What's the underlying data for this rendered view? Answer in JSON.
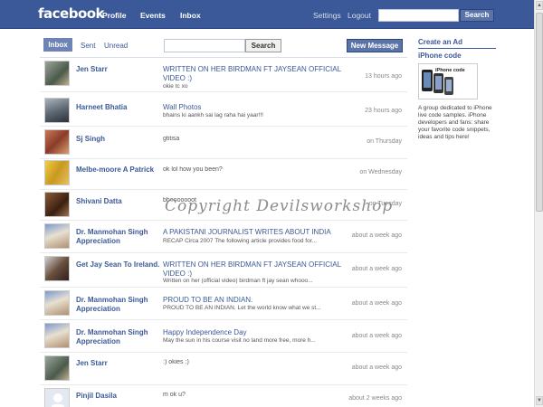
{
  "topbar": {
    "logo": "facebook",
    "nav": [
      "Profile",
      "Events",
      "Inbox"
    ],
    "settings": "Settings",
    "logout": "Logout",
    "search_button": "Search"
  },
  "inbox": {
    "tabs": [
      "Inbox",
      "Sent",
      "Unread"
    ],
    "search_button": "Search",
    "new_message_button": "New Message"
  },
  "messages": [
    {
      "sender": "Jen Starr",
      "subject": "WRITTEN ON HER BIRDMAN FT JAYSEAN OFFICIAL VIDEO :)",
      "snippet": "okie tc xo",
      "time": "13 hours ago"
    },
    {
      "sender": "Harneet Bhatia",
      "subject": "Wall Photos",
      "snippet": "bhains ki aankh sai lag raha hai yaar!!!",
      "time": "23 hours ago"
    },
    {
      "sender": "Sj Singh",
      "subject": "",
      "snippet": "gtitisa",
      "time": "on Thursday"
    },
    {
      "sender": "Melbe-moore A Patrick",
      "subject": "",
      "snippet": "ok lol how you been?",
      "time": "on Wednesday"
    },
    {
      "sender": "Shivani Datta",
      "subject": "",
      "snippet": "bhooooooot",
      "time": "on Tuesday"
    },
    {
      "sender": "Dr. Manmohan Singh Appreciation",
      "subject": "A PAKISTANI JOURNALIST WRITES ABOUT INDIA",
      "snippet": "RECAP Circa 2007 The following article provides food for...",
      "time": "about a week ago"
    },
    {
      "sender": "Get Jay Sean To Ireland.",
      "subject": "WRITTEN ON HER BIRDMAN FT JAYSEAN OFFICIAL VIDEO :)",
      "snippet": "Written on her (official video) birdman ft jay sean whooo...",
      "time": "about a week ago"
    },
    {
      "sender": "Dr. Manmohan Singh Appreciation",
      "subject": "PROUD TO BE AN INDIAN.",
      "snippet": "PROUD TO BE AN INDIAN. Let the world know what we st...",
      "time": "about a week ago"
    },
    {
      "sender": "Dr. Manmohan Singh Appreciation",
      "subject": "Happy Independence Day",
      "snippet": "May the sun in his course visit no land more free, more h...",
      "time": "about a week ago"
    },
    {
      "sender": "Jen Starr",
      "subject": "",
      "snippet": ":) okies :)",
      "time": "about a week ago"
    },
    {
      "sender": "Pinjil Dasila",
      "subject": "",
      "snippet": "m ok u?",
      "time": "about 2 weeks ago"
    }
  ],
  "sidebar": {
    "create_ad": "Create an Ad",
    "ad_title": "iPhone code",
    "ad_image_text": "iPhone code",
    "ad_text": "A group dedicated to iPhone live code samples. iPhone developers and fans: share your favorite code snippets, ideas and tips here!"
  },
  "watermark": "Copyright Devilsworkshop",
  "colors": {
    "brand": "#3b5998",
    "button": "#5b74a8",
    "tab_active": "#6d84b4"
  }
}
